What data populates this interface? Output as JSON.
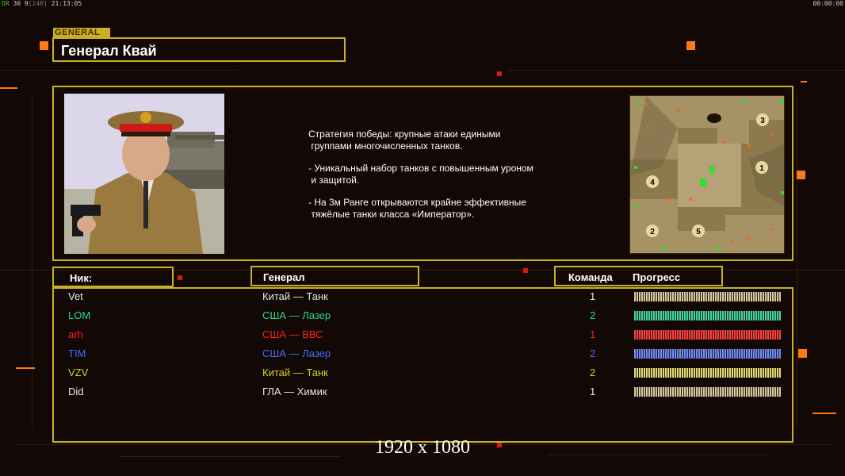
{
  "topbar": {
    "left_status": "30 9",
    "left_bracket": "[240]",
    "left_time": "21:13:05",
    "left_prefix": "DR",
    "right_time": "00:00:00"
  },
  "general": {
    "tag": "GENERAL",
    "name": "Генерал Квай",
    "description": [
      "Стратегия победы: крупные атаки едиными\n группами многочисленных танков.",
      "- Уникальный набор танков с повышенным уроном\n и защитой.",
      "- На 3м Ранге открываются крайне эффективные\n тяжёлые танки класса «Император»."
    ]
  },
  "minimap": {
    "spawns": [
      "3",
      "1",
      "4",
      "2",
      "5"
    ]
  },
  "headers": {
    "nick": "Ник:",
    "general": "Генерал",
    "team": "Команда",
    "progress": "Прогресс"
  },
  "players": [
    {
      "nick": "Vet",
      "general": "Китай — Танк",
      "team": "1",
      "color": "#e8e8e8",
      "bar": "#d8c8a0"
    },
    {
      "nick": "LOM",
      "general": "США — Лазер",
      "team": "2",
      "color": "#2fd98a",
      "bar": "#3ed8a6"
    },
    {
      "nick": "arh",
      "general": "США — ВВС",
      "team": "1",
      "color": "#ff2020",
      "bar": "#ff3a3a"
    },
    {
      "nick": "TIM",
      "general": "США — Лазер",
      "team": "2",
      "color": "#4a6bff",
      "bar": "#6a8bff"
    },
    {
      "nick": "VZV",
      "general": "Китай — Танк",
      "team": "2",
      "color": "#d8d020",
      "bar": "#e0dc70"
    },
    {
      "nick": "Did",
      "general": "ГЛА — Химик",
      "team": "1",
      "color": "#e8e8e8",
      "bar": "#d8c8a0"
    }
  ],
  "resolution": "1920 x 1080"
}
